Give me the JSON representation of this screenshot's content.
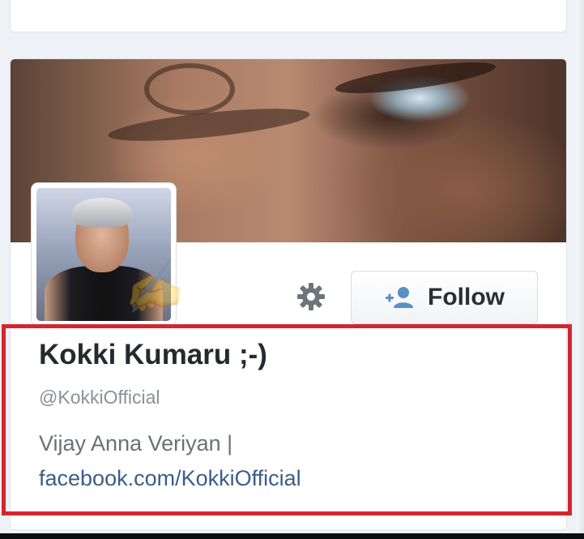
{
  "profile": {
    "name": "Kokki Kumaru ;-)",
    "handle": "@KokkiOfficial",
    "bio_line1": "Vijay Anna Veriyan |",
    "bio_link": "facebook.com/KokkiOfficial"
  },
  "actions": {
    "follow_label": "Follow",
    "settings_icon": "gear-icon",
    "follow_icon": "add-user-icon"
  },
  "colors": {
    "highlight_border": "#d1272f",
    "link": "#3b5d88"
  }
}
